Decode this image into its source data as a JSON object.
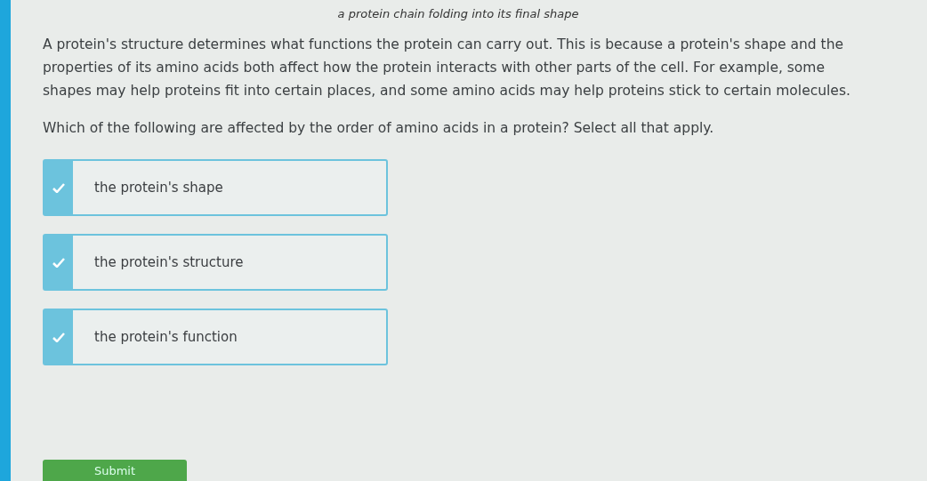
{
  "image_caption": "a protein chain folding into its final shape",
  "passage": "A protein's structure determines what functions the protein can carry out. This is because a protein's shape and the properties of its amino acids both affect how the protein interacts with other parts of the cell. For example, some shapes may help proteins fit into certain places, and some amino acids may help proteins stick to certain molecules.",
  "question": "Which of the following are affected by the order of amino acids in a protein? Select all that apply.",
  "options": [
    {
      "label": "the protein's shape",
      "checked": true
    },
    {
      "label": "the protein's structure",
      "checked": true
    },
    {
      "label": "the protein's function",
      "checked": true
    }
  ],
  "submit_button": "Submit"
}
